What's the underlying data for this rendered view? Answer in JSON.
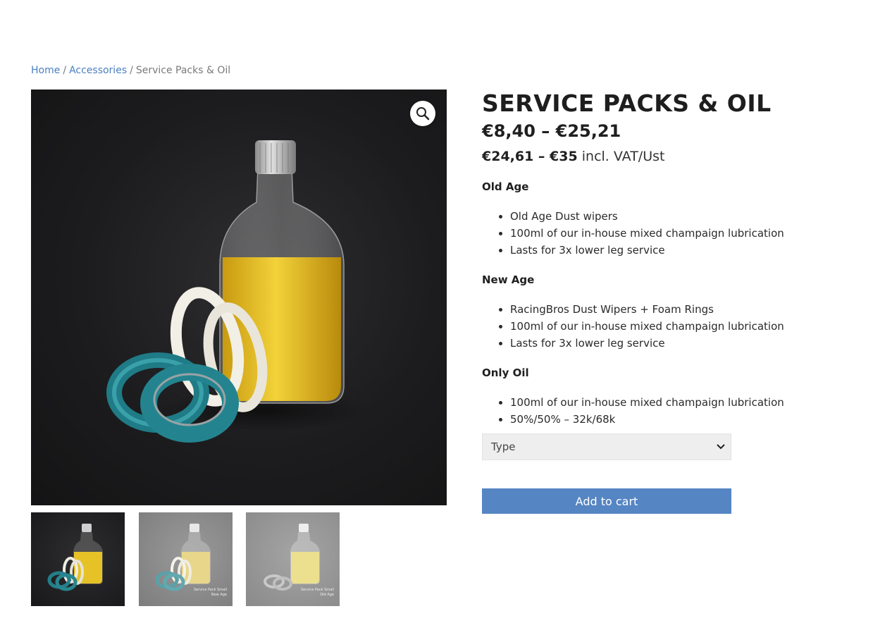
{
  "breadcrumb": {
    "home": "Home",
    "category": "Accessories",
    "current": "Service Packs & Oil",
    "separator": "/"
  },
  "product": {
    "title": "SERVICE PACKS & OIL",
    "price_ex_vat": "€8,40 – €25,21",
    "price_incl_vat": "€24,61 – €35",
    "price_incl_suffix": "incl. VAT/Ust",
    "sections": [
      {
        "heading": "Old Age",
        "items": [
          "Old Age Dust wipers",
          "100ml of our in-house mixed champaign lubrication",
          "Lasts for 3x lower leg service"
        ]
      },
      {
        "heading": "New Age",
        "items": [
          "RacingBros Dust Wipers + Foam Rings",
          "100ml of our in-house mixed champaign lubrication",
          "Lasts for 3x lower leg service"
        ]
      },
      {
        "heading": "Only Oil",
        "items": [
          "100ml of our in-house mixed champaign lubrication",
          "50%/50% – 32k/68k"
        ]
      }
    ]
  },
  "form": {
    "type_select_value": "Type",
    "add_to_cart_label": "Add to cart"
  },
  "gallery": {
    "thumb2_caption_1": "Service Pack Small",
    "thumb2_caption_2": "New Age",
    "thumb3_caption_1": "Service Pack Small",
    "thumb3_caption_2": "Old Age"
  },
  "icons": {
    "zoom": "magnifier-icon",
    "dropdown": "chevron-down-icon"
  },
  "colors": {
    "button_bg": "#5585c3",
    "link": "#4a7fc1",
    "photo_bg": "#1c1c1e",
    "oil": "#e8c21a",
    "seal": "#2a8f9a"
  }
}
